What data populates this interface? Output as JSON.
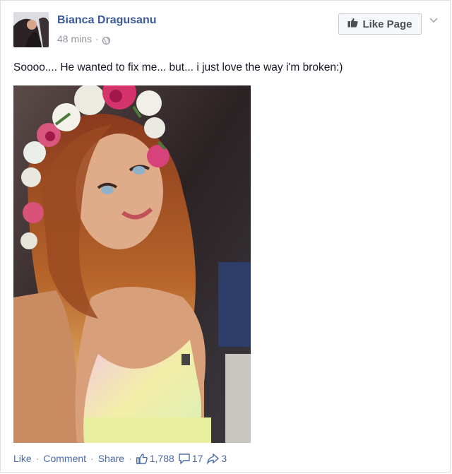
{
  "post": {
    "author": "Bianca Dragusanu",
    "time": "48 mins",
    "meta_separator": "·",
    "like_page_label": "Like Page",
    "caption": "Soooo.... He wanted to fix me... but... i just love the way i'm broken:)"
  },
  "footer": {
    "like_label": "Like",
    "comment_label": "Comment",
    "share_label": "Share",
    "separator": "·",
    "likes_count": "1,788",
    "comments_count": "17",
    "shares_count": "3"
  },
  "colors": {
    "link_blue": "#3b5998",
    "footer_blue": "#4b6ba6",
    "muted_gray": "#90949c",
    "button_bg": "#f6f7f9"
  },
  "icons": {
    "avatar": "profile-photo",
    "globe": "globe-icon",
    "thumbs_up": "thumbs-up-icon",
    "chevron": "chevron-down-icon",
    "comment": "comment-bubble-icon",
    "share": "share-arrow-icon"
  }
}
